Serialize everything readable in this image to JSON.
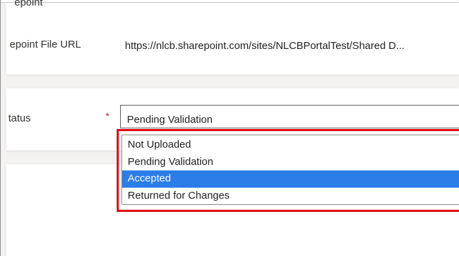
{
  "colors": {
    "page_bg": "#f3f2f1",
    "card_bg": "#ffffff",
    "required_star": "#a4262c",
    "highlight_border": "#e3000f",
    "selected_option_bg": "#2b7de9"
  },
  "form": {
    "cut_off_label": "epoint",
    "sharepoint_url_label": "epoint File URL",
    "sharepoint_url_value": "https://nlcb.sharepoint.com/sites/NLCBPortalTest/Shared D...",
    "status_label": "tatus",
    "required_marker": "*",
    "status_value": "Pending Validation",
    "status_options": [
      "Not Uploaded",
      "Pending Validation",
      "Accepted",
      "Returned for Changes"
    ],
    "highlighted_option": "Accepted"
  }
}
